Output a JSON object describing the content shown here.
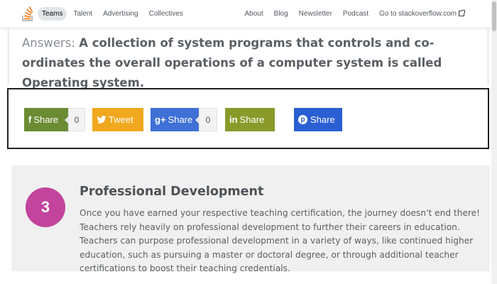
{
  "topbar": {
    "nav_left": [
      "Teams",
      "Talent",
      "Advertising",
      "Collectives"
    ],
    "nav_right": [
      "About",
      "Blog",
      "Newsletter",
      "Podcast"
    ],
    "external_link": "Go to stackoverflow.com"
  },
  "answer": {
    "label": "Answers:",
    "text": "A collection of system programs that controls and co-ordinates the overall operations of a computer system is called Operating system."
  },
  "share": {
    "facebook": {
      "label": "Share",
      "count": "0",
      "icon": "f"
    },
    "twitter": {
      "label": "Tweet"
    },
    "googleplus": {
      "label": "Share",
      "count": "0",
      "icon": "g+"
    },
    "linkedin": {
      "label": "Share",
      "icon": "in"
    },
    "pinterest": {
      "label": "Share",
      "icon": "p"
    }
  },
  "card": {
    "number": "3",
    "title": "Professional Development",
    "body": "Once you have earned your respective teaching certification, the journey doesn't end there! Teachers rely heavily on professional development to further their careers in education. Teachers can purpose professional development in a variety of ways, like continued higher education, such as pursuing a master or doctoral degree, or through additional teacher certifications to boost their teaching credentials."
  },
  "colors": {
    "facebook": "#6b8c33",
    "twitter": "#f0a81e",
    "googleplus": "#3e70d6",
    "linkedin": "#8a9a2a",
    "pinterest": "#2a5fd4",
    "step_circle": "#c2449c"
  }
}
